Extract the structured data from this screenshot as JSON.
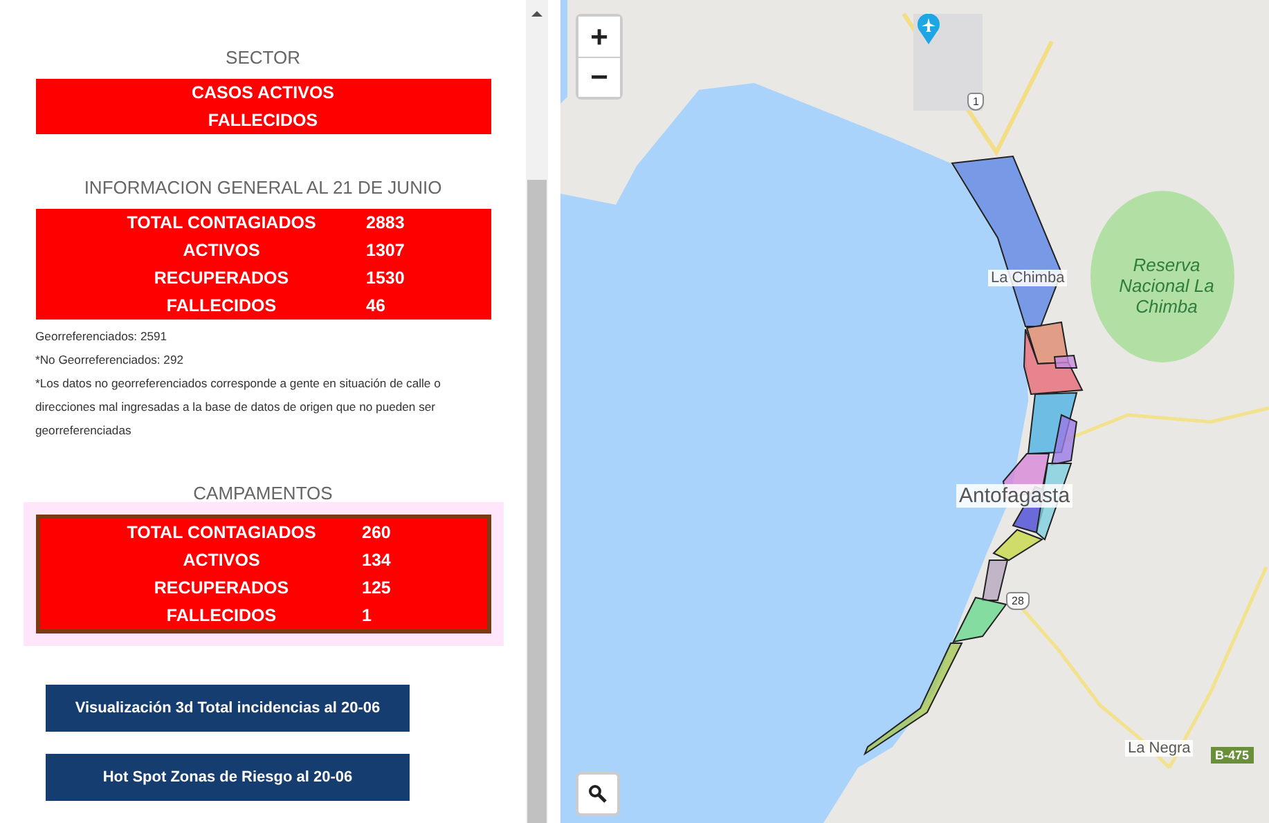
{
  "sidebar": {
    "sector": {
      "title": "SECTOR",
      "lines": [
        "CASOS ACTIVOS",
        "FALLECIDOS"
      ]
    },
    "general": {
      "title": "INFORMACION GENERAL AL 21 DE JUNIO",
      "rows": [
        {
          "label": "TOTAL CONTAGIADOS",
          "value": "2883"
        },
        {
          "label": "ACTIVOS",
          "value": "1307"
        },
        {
          "label": "RECUPERADOS",
          "value": "1530"
        },
        {
          "label": "FALLECIDOS",
          "value": "46"
        }
      ],
      "notes": [
        "Georreferenciados: 2591",
        "*No Georreferenciados: 292",
        "*Los datos no georreferenciados corresponde a gente en situación de calle o direcciones mal ingresadas a la base de datos de origen que no pueden ser georreferenciadas"
      ]
    },
    "campamentos": {
      "title": "CAMPAMENTOS",
      "rows": [
        {
          "label": "TOTAL CONTAGIADOS",
          "value": "260"
        },
        {
          "label": "ACTIVOS",
          "value": "134"
        },
        {
          "label": "RECUPERADOS",
          "value": "125"
        },
        {
          "label": "FALLECIDOS",
          "value": "1"
        }
      ]
    },
    "buttons": [
      "Visualización 3d Total incidencias al 20-06",
      "Hot Spot Zonas de Riesgo al 20-06"
    ]
  },
  "map": {
    "zoom_in": "+",
    "zoom_out": "−",
    "labels": [
      {
        "kind": "shield",
        "text": "1"
      },
      {
        "kind": "place",
        "text": "La Chimba"
      },
      {
        "kind": "park",
        "text": "Reserva Nacional La Chimba"
      },
      {
        "kind": "city",
        "text": "Antofagasta"
      },
      {
        "kind": "shield",
        "text": "28"
      },
      {
        "kind": "place",
        "text": "La Negra"
      },
      {
        "kind": "route",
        "text": "B-475"
      }
    ]
  }
}
